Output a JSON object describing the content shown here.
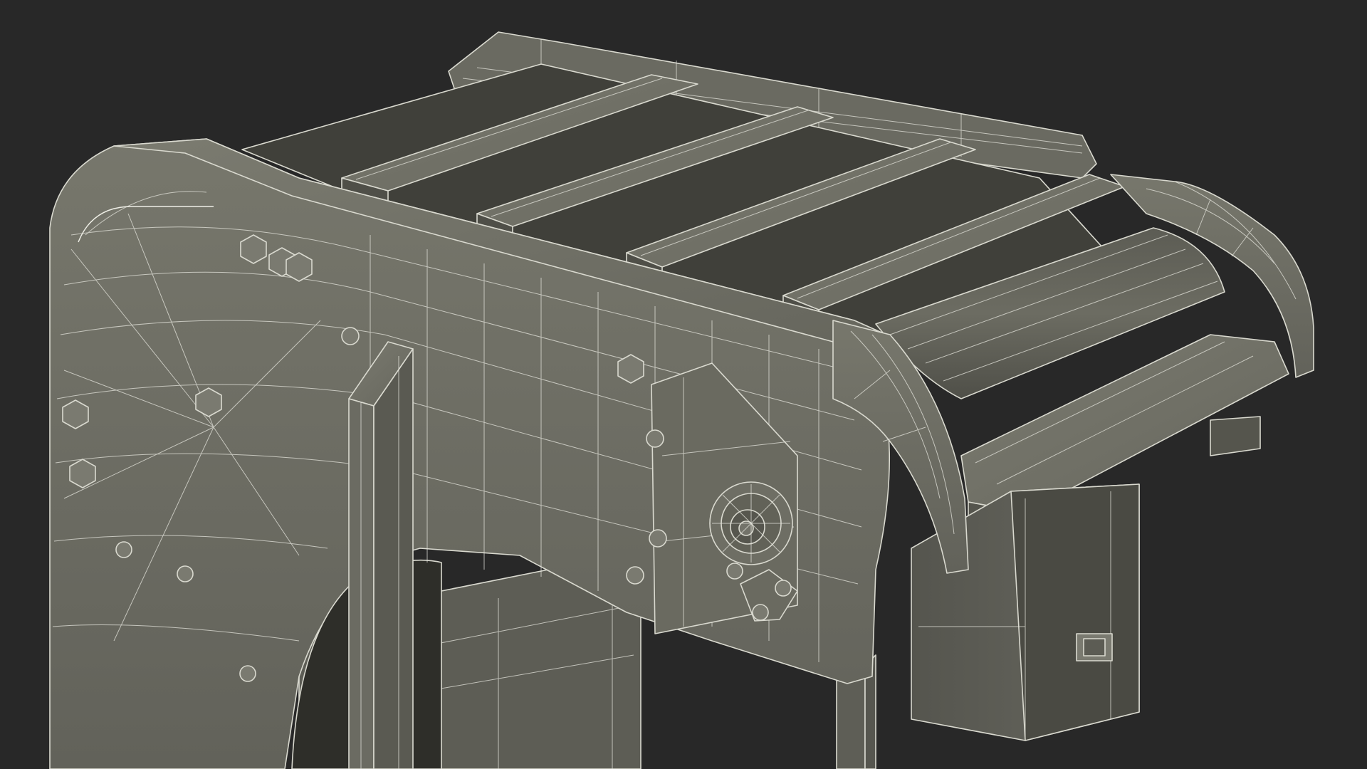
{
  "scene": {
    "subject": "conveyor-wireframe",
    "colors": {
      "background": "#282828",
      "surface": "#6d6d63",
      "surface_light": "#7c7c71",
      "surface_dark": "#4c4c45",
      "shadow": "#3a3a34",
      "wire": "#e4e4dc"
    }
  }
}
